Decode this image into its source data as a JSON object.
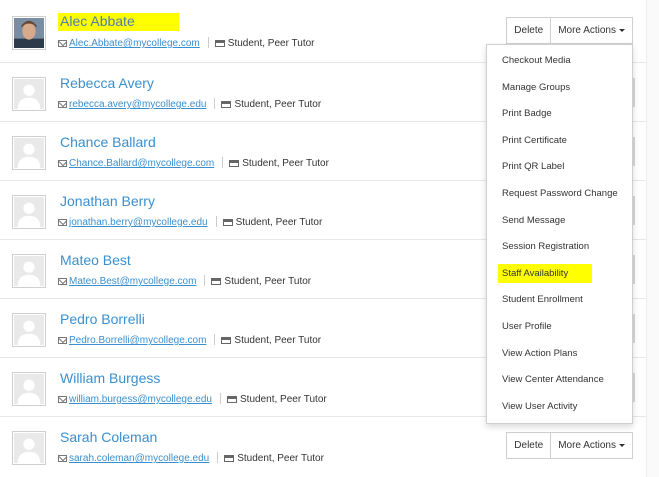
{
  "rows": [
    {
      "name": "Alec Abbate",
      "email": "Alec.Abbate@mycollege.com",
      "roles": "Student, Peer Tutor",
      "highlighted": true,
      "photo": true
    },
    {
      "name": "Rebecca Avery",
      "email": "rebecca.avery@mycollege.edu",
      "roles": "Student, Peer Tutor"
    },
    {
      "name": "Chance Ballard",
      "email": "Chance.Ballard@mycollege.com",
      "roles": "Student, Peer Tutor"
    },
    {
      "name": "Jonathan Berry",
      "email": "jonathan.berry@mycollege.edu",
      "roles": "Student, Peer Tutor"
    },
    {
      "name": "Mateo Best",
      "email": "Mateo.Best@mycollege.com",
      "roles": "Student, Peer Tutor"
    },
    {
      "name": "Pedro Borrelli",
      "email": "Pedro.Borrelli@mycollege.com",
      "roles": "Student, Peer Tutor"
    },
    {
      "name": "William Burgess",
      "email": "william.burgess@mycollege.edu",
      "roles": "Student, Peer Tutor"
    },
    {
      "name": "Sarah Coleman",
      "email": "sarah.coleman@mycollege.edu",
      "roles": "Student, Peer Tutor"
    }
  ],
  "actions": {
    "delete_label": "Delete",
    "more_label": "More Actions"
  },
  "menu": {
    "items": [
      "Checkout Media",
      "Manage Groups",
      "Print Badge",
      "Print Certificate",
      "Print QR Label",
      "Request Password Change",
      "Send Message",
      "Session Registration",
      "Staff Availability",
      "Student Enrollment",
      "User Profile",
      "View Action Plans",
      "View Center Attendance",
      "View User Activity"
    ],
    "highlighted_item": "Staff Availability"
  },
  "colors": {
    "link": "#3a8fcf",
    "highlight": "#ffff00"
  }
}
